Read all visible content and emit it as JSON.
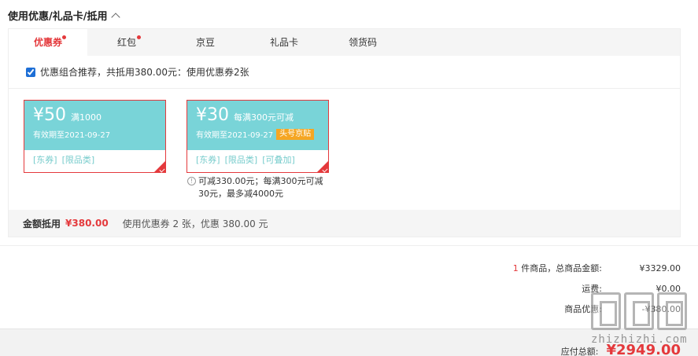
{
  "section": {
    "title": "使用优惠/礼品卡/抵用"
  },
  "tabs": [
    {
      "label": "优惠券",
      "active": true,
      "dot": true
    },
    {
      "label": "红包",
      "active": false,
      "dot": true
    },
    {
      "label": "京豆",
      "active": false,
      "dot": false
    },
    {
      "label": "礼品卡",
      "active": false,
      "dot": false
    },
    {
      "label": "领货码",
      "active": false,
      "dot": false
    }
  ],
  "combo": {
    "checked": true,
    "text": "优惠组合推荐，共抵用380.00元：使用优惠券2张"
  },
  "coupons": [
    {
      "amount": "¥50",
      "condition": "满1000",
      "valid": "有效期至2021-09-27",
      "badge": "",
      "tags": [
        "[东券]",
        "[限品类]"
      ]
    },
    {
      "amount": "¥30",
      "condition": "每满300元可减",
      "valid": "有效期至2021-09-27",
      "badge": "头号京贴",
      "tags": [
        "[东券]",
        "[限品类]",
        "[可叠加]"
      ]
    }
  ],
  "coupon_note": "可减330.00元；每满300元可减30元，最多减4000元",
  "summary": {
    "label": "金额抵用",
    "amount": "¥380.00",
    "desc": "使用优惠券 2 张，优惠 380.00 元"
  },
  "totals": {
    "count": "1",
    "goods_label": " 件商品，总商品金额:",
    "goods_value": "¥3329.00",
    "shipping_label": "运费:",
    "shipping_value": "¥0.00",
    "discount_label": "商品优惠:",
    "discount_value": "-¥380.00"
  },
  "payable": {
    "label": "应付总额:",
    "value": "¥2949.00"
  },
  "watermark": {
    "text": "zhizhizhi.com"
  },
  "colors": {
    "accent": "#e4393c",
    "coupon_bg": "#79d4d8",
    "badge": "#f5a623"
  }
}
